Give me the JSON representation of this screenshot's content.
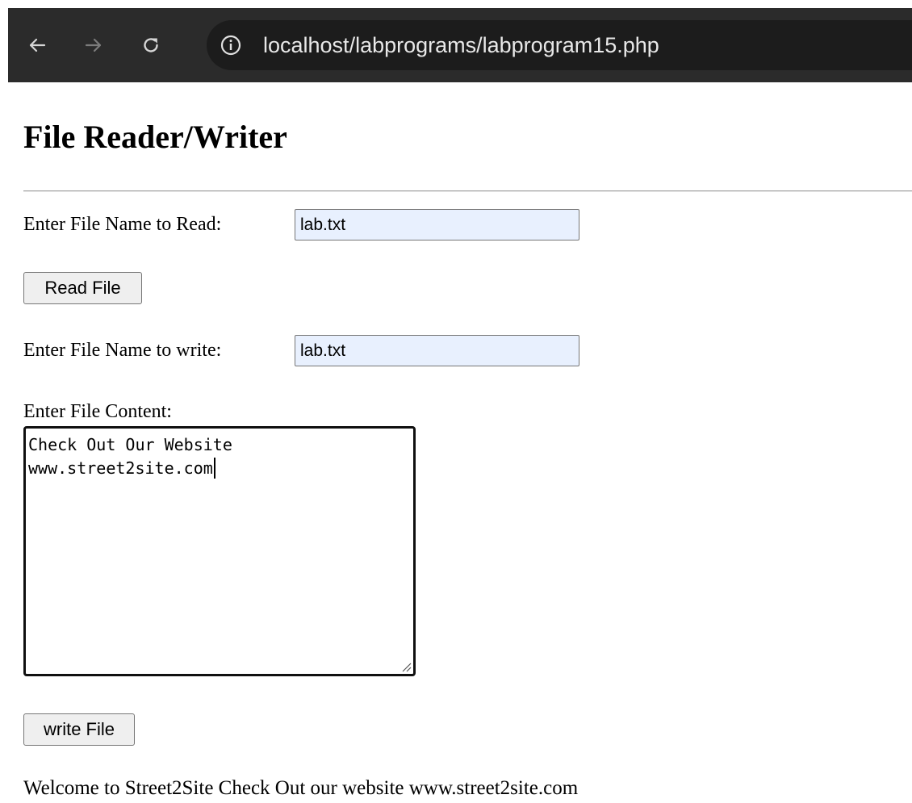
{
  "browser": {
    "url": "localhost/labprograms/labprogram15.php",
    "icons": {
      "back": "arrow-left-icon",
      "forward": "arrow-right-icon",
      "reload": "reload-icon",
      "site_info": "info-circle-icon"
    },
    "colors": {
      "toolbar_bg": "#2b2b2b",
      "omnibox_bg": "#1c1c1c",
      "url_text": "#e8e8e8"
    }
  },
  "page": {
    "title": "File Reader/Writer",
    "read_section": {
      "label": "Enter File Name to Read:",
      "input_value": "lab.txt",
      "button_label": "Read File"
    },
    "write_section": {
      "label": "Enter File Name to write:",
      "input_value": "lab.txt",
      "content_label": "Enter File Content:",
      "content_lines": [
        "Check Out Our Website",
        "www.street2site.com"
      ],
      "button_label": "write File"
    },
    "output_text": "Welcome to Street2Site Check Out our website www.street2site.com",
    "colors": {
      "autofill_input_bg": "#e8f0fe",
      "button_bg": "#efefef"
    }
  }
}
